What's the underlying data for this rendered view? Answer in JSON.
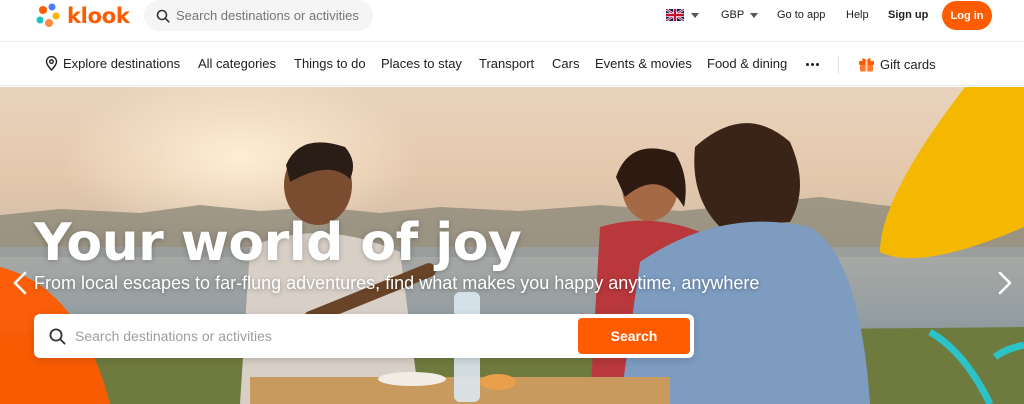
{
  "brand": {
    "name": "klook",
    "accent": "#ff5b00"
  },
  "header": {
    "search_placeholder": "Search destinations or activities",
    "language": {
      "flag": "uk-flag-icon"
    },
    "currency": "GBP",
    "go_to_app": "Go to app",
    "help": "Help",
    "sign_up": "Sign up",
    "log_in": "Log in"
  },
  "nav": {
    "explore": "Explore destinations",
    "items": [
      "All categories",
      "Things to do",
      "Places to stay",
      "Transport",
      "Cars",
      "Events & movies",
      "Food & dining"
    ],
    "more_icon": "more-dots-icon",
    "gift_cards": "Gift cards"
  },
  "hero": {
    "title": "Your world of joy",
    "subtitle": "From local escapes to far-flung adventures, find what makes you happy anytime, anywhere",
    "search_placeholder": "Search destinations or activities",
    "search_button": "Search"
  }
}
